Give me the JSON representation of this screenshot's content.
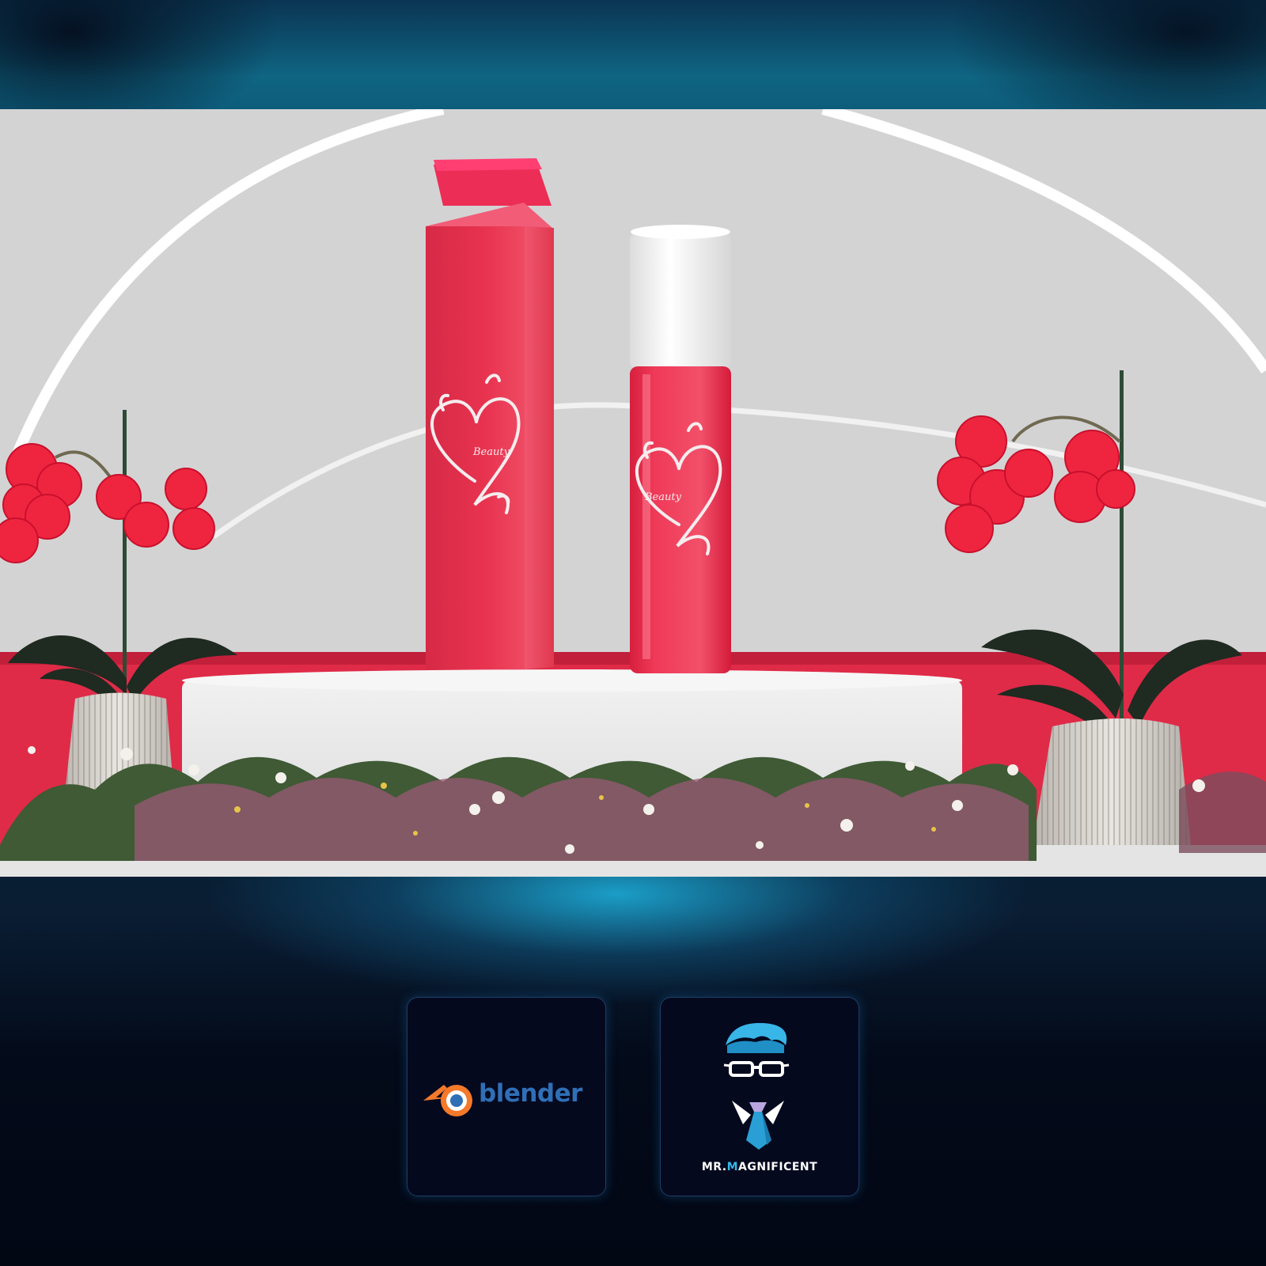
{
  "scene": {
    "box_logo_text": "Beauty",
    "bottle_logo_text": "Beauty",
    "colors": {
      "brand_red": "#e8334f",
      "cap_white": "#f4f4f4",
      "orchid_red": "#ef2540",
      "podium": "#e6e6e6"
    }
  },
  "logos": {
    "blender": {
      "wordmark": "blender",
      "icon": "blender-logo-icon",
      "colors": {
        "orange": "#f5792a",
        "blue": "#2f6fb6"
      }
    },
    "mr_magnificent": {
      "wordmark_part1": "MR.",
      "wordmark_accent": "M",
      "wordmark_part2": "AGNIFICENT",
      "icon": "mr-magnificent-mascot-icon",
      "colors": {
        "hair": "#38b6e8",
        "tie": "#2a9fd6"
      }
    }
  }
}
